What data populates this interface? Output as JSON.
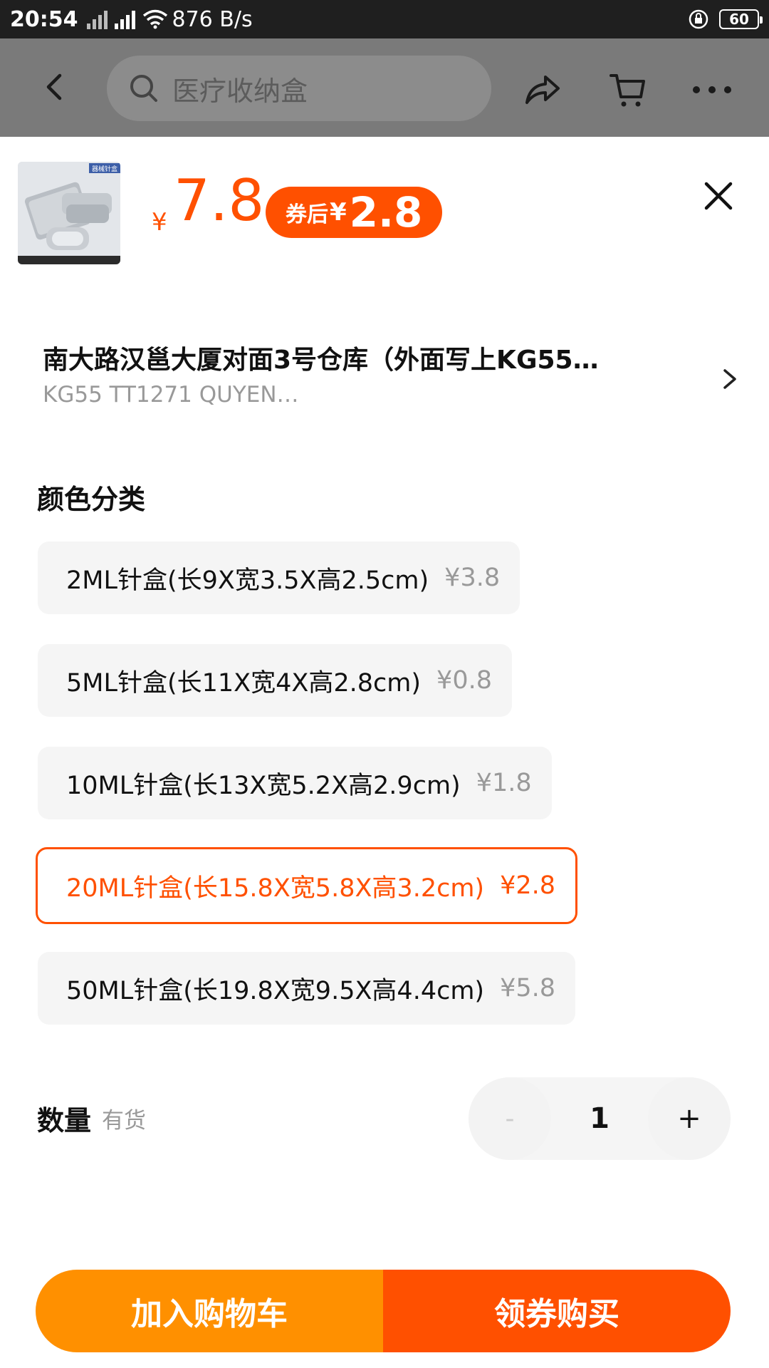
{
  "status_bar": {
    "time": "20:54",
    "network_speed": "876 B/s",
    "network_type": "4G",
    "battery": "60"
  },
  "header": {
    "search_placeholder": "医疗收纳盒",
    "icons": [
      "back-icon",
      "search-icon",
      "share-icon",
      "cart-icon",
      "more-icon"
    ]
  },
  "product": {
    "thumb_label": "器械针盒",
    "currency": "¥",
    "price": "7.8",
    "coupon_label": "券后",
    "coupon_currency": "¥",
    "coupon_price": "2.8"
  },
  "address": {
    "line1": "南大路汉邕大厦对面3号仓库（外面写上KG55…",
    "line2": "KG55 TT1271 QUYEN…"
  },
  "options_section": {
    "title": "颜色分类",
    "options": [
      {
        "label": "2ML针盒(长9X宽3.5X高2.5cm)",
        "price": "¥3.8",
        "selected": false
      },
      {
        "label": "5ML针盒(长11X宽4X高2.8cm)",
        "price": "¥0.8",
        "selected": false
      },
      {
        "label": "10ML针盒(长13X宽5.2X高2.9cm)",
        "price": "¥1.8",
        "selected": false
      },
      {
        "label": "20ML针盒(长15.8X宽5.8X高3.2cm)",
        "price": "¥2.8",
        "selected": true
      },
      {
        "label": "50ML针盒(长19.8X宽9.5X高4.4cm)",
        "price": "¥5.8",
        "selected": false
      }
    ]
  },
  "quantity": {
    "label": "数量",
    "stock": "有货",
    "minus": "-",
    "value": "1",
    "plus": "+"
  },
  "actions": {
    "add_to_cart": "加入购物车",
    "buy": "领券购买"
  },
  "colors": {
    "accent": "#ff5000",
    "cart_button": "#ff9000"
  }
}
